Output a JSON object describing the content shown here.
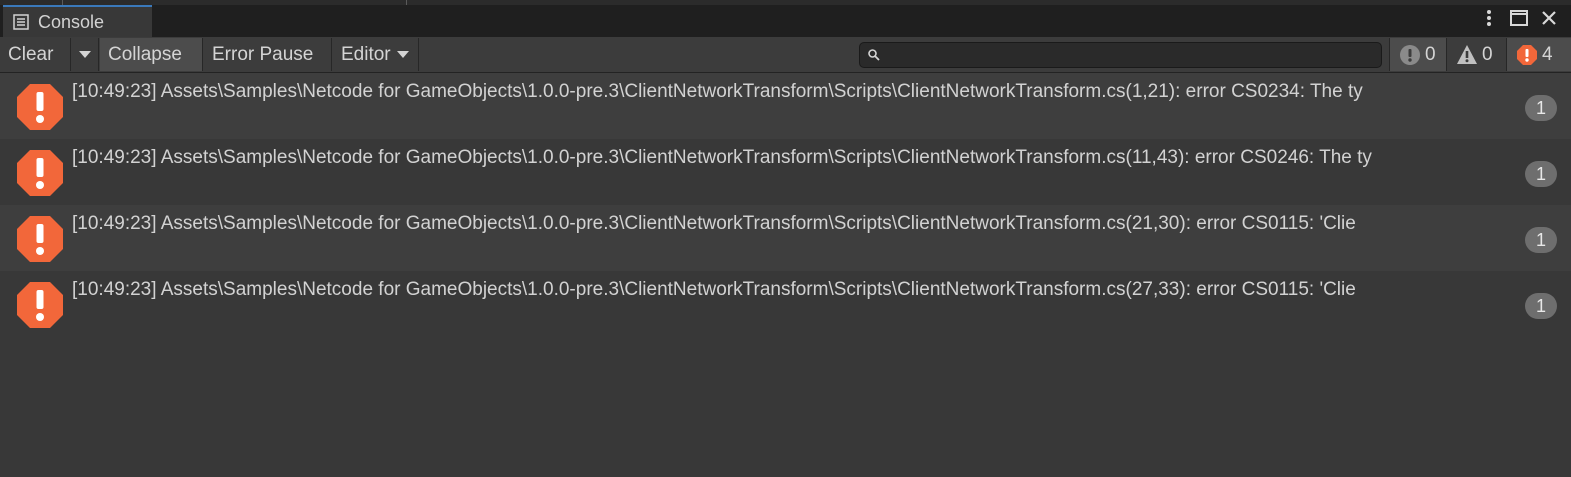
{
  "window": {
    "tab_title": "Console",
    "tab_icon": "console-list-icon",
    "controls": [
      "more-options-icon",
      "maximize-icon",
      "close-icon"
    ]
  },
  "toolbar": {
    "clear_label": "Clear",
    "collapse_label": "Collapse",
    "error_pause_label": "Error Pause",
    "editor_label": "Editor",
    "search": {
      "value": "",
      "placeholder": ""
    },
    "counts": {
      "log": "0",
      "warning": "0",
      "error": "4"
    }
  },
  "entries": [
    {
      "text": "[10:49:23] Assets\\Samples\\Netcode for GameObjects\\1.0.0-pre.3\\ClientNetworkTransform\\Scripts\\ClientNetworkTransform.cs(1,21): error CS0234: The ty",
      "count": "1"
    },
    {
      "text": "[10:49:23] Assets\\Samples\\Netcode for GameObjects\\1.0.0-pre.3\\ClientNetworkTransform\\Scripts\\ClientNetworkTransform.cs(11,43): error CS0246: The ty",
      "count": "1"
    },
    {
      "text": "[10:49:23] Assets\\Samples\\Netcode for GameObjects\\1.0.0-pre.3\\ClientNetworkTransform\\Scripts\\ClientNetworkTransform.cs(21,30): error CS0115: 'Clie",
      "count": "1"
    },
    {
      "text": "[10:49:23] Assets\\Samples\\Netcode for GameObjects\\1.0.0-pre.3\\ClientNetworkTransform\\Scripts\\ClientNetworkTransform.cs(27,33): error CS0115: 'Clie",
      "count": "1"
    }
  ],
  "colors": {
    "error_icon": "#f2673a",
    "warning_icon": "#c0c0c0",
    "log_icon": "#8a8a8a",
    "tab_accent": "#3a79bb"
  }
}
